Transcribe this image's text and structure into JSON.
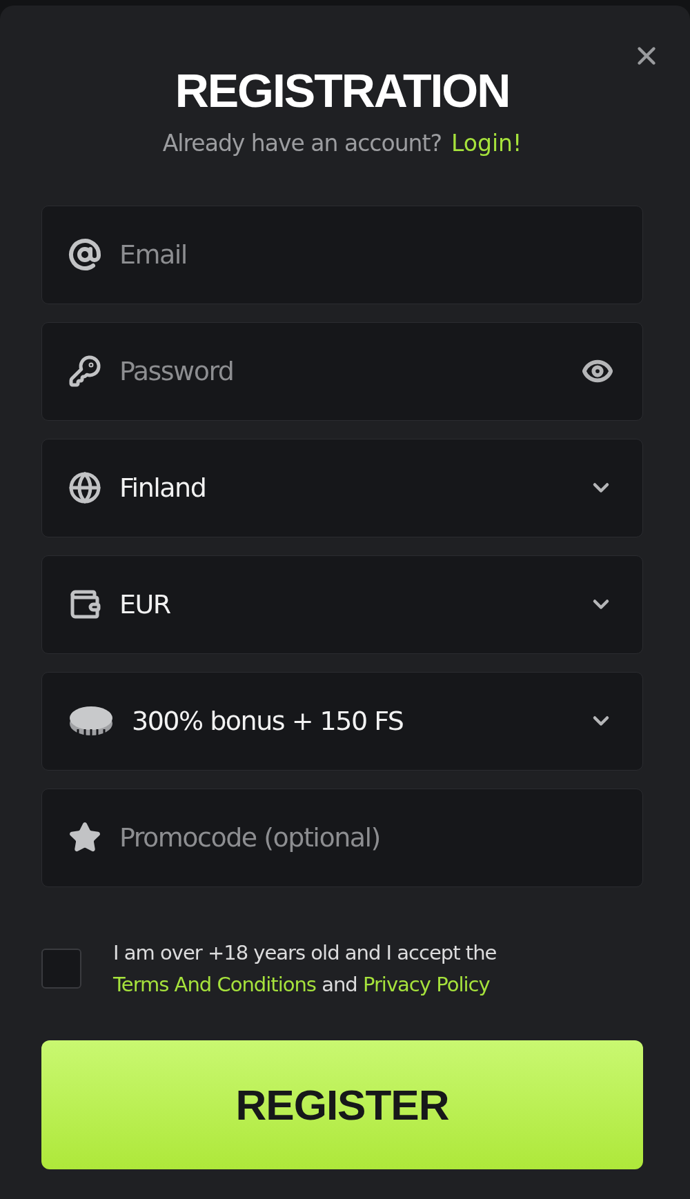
{
  "title": "REGISTRATION",
  "subtitle": {
    "text": "Already have an account?",
    "link": "Login!"
  },
  "fields": [
    {
      "kind": "text",
      "placeholder": "Email"
    },
    {
      "kind": "password",
      "placeholder": "Password"
    },
    {
      "kind": "select",
      "value": "Finland"
    },
    {
      "kind": "select",
      "value": "EUR"
    },
    {
      "kind": "select",
      "value": "300% bonus + 150 FS"
    },
    {
      "kind": "text",
      "placeholder": "Promocode (optional)"
    }
  ],
  "consent": {
    "checked": false,
    "text": "I am over +18 years old and I accept the",
    "terms": "Terms And Conditions",
    "joiner": "and",
    "privacy": "Privacy Policy"
  },
  "button": "REGISTER"
}
